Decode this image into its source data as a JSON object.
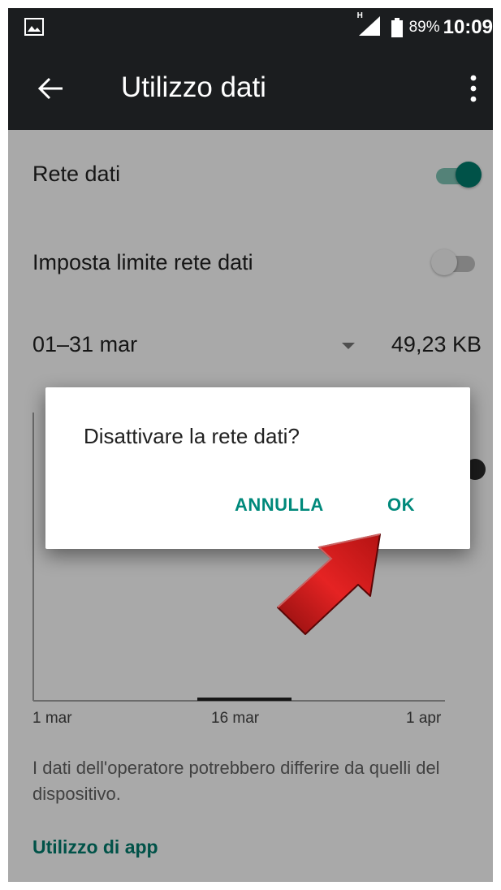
{
  "status_bar": {
    "network_label": "H",
    "battery_percent": "89%",
    "time": "10:09"
  },
  "toolbar": {
    "title": "Utilizzo dati",
    "back_icon": "arrow-back-icon",
    "menu_icon": "more-vert-icon"
  },
  "settings": {
    "mobile_data_label": "Rete dati",
    "mobile_data_on": true,
    "set_limit_label": "Imposta limite rete dati",
    "set_limit_on": false,
    "cycle_label": "01–31 mar",
    "cycle_usage": "49,23 KB"
  },
  "chart": {
    "ticks": [
      "1 mar",
      "16 mar",
      "1 apr"
    ]
  },
  "disclaimer": "I dati dell'operatore potrebbero differire da quelli del dispositivo.",
  "app_usage_link": "Utilizzo di app",
  "dialog": {
    "message": "Disattivare la rete dati?",
    "cancel_label": "ANNULLA",
    "ok_label": "OK"
  },
  "colors": {
    "accent": "#00796b",
    "toolbar": "#1b1d1f",
    "arrow": "#d81c1c"
  }
}
